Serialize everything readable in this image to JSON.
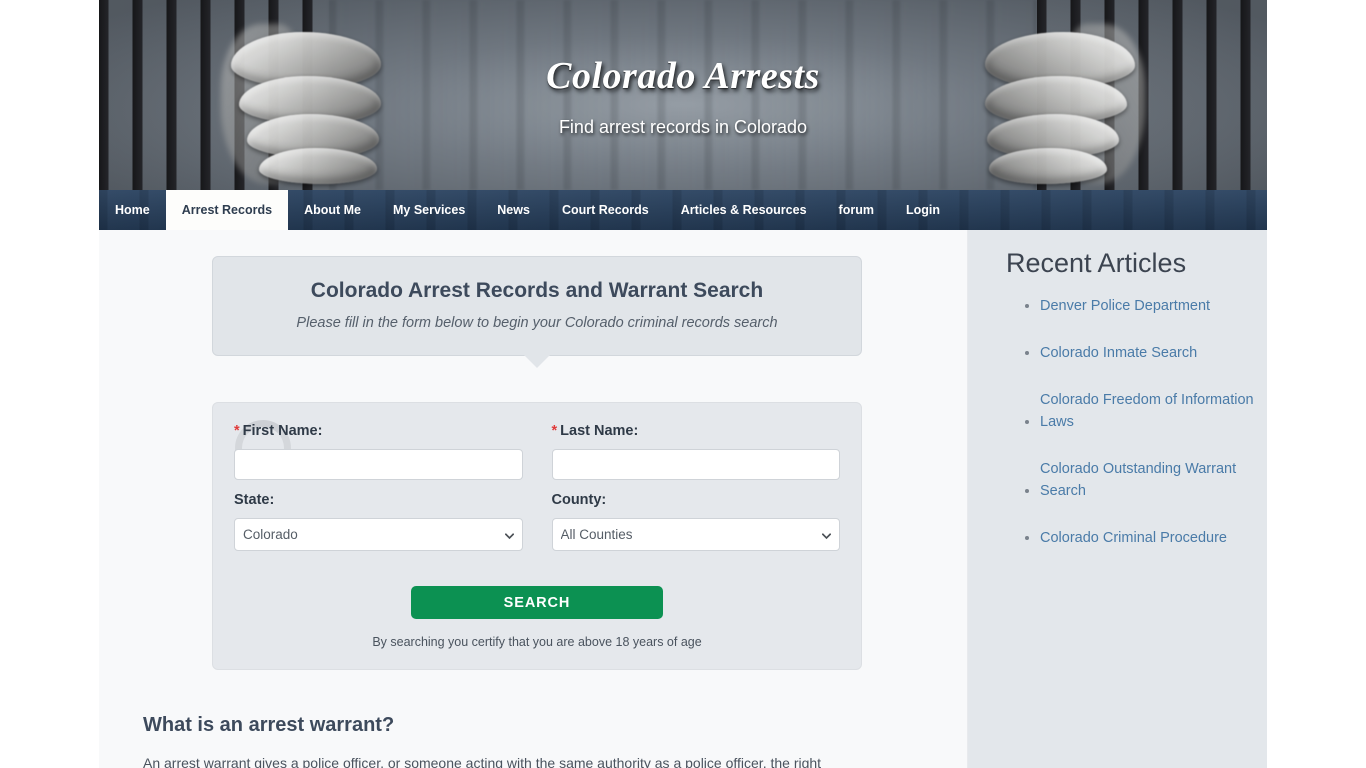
{
  "banner": {
    "title": "Colorado Arrests",
    "tagline": "Find arrest records in Colorado"
  },
  "nav": {
    "items": [
      {
        "label": "Home",
        "active": false
      },
      {
        "label": "Arrest Records",
        "active": true
      },
      {
        "label": "About Me",
        "active": false
      },
      {
        "label": "My Services",
        "active": false
      },
      {
        "label": "News",
        "active": false
      },
      {
        "label": "Court Records",
        "active": false
      },
      {
        "label": "Articles & Resources",
        "active": false
      },
      {
        "label": "forum",
        "active": false
      },
      {
        "label": "Login",
        "active": false
      }
    ]
  },
  "callout": {
    "title": "Colorado Arrest Records and Warrant Search",
    "subtitle": "Please fill in the form below to begin your Colorado criminal records search"
  },
  "form": {
    "first_name": {
      "label": "First Name:",
      "required_mark": "*",
      "value": "",
      "placeholder": ""
    },
    "last_name": {
      "label": "Last Name:",
      "required_mark": "*",
      "value": "",
      "placeholder": ""
    },
    "state": {
      "label": "State:",
      "selected": "Colorado",
      "options": [
        "Colorado"
      ]
    },
    "county": {
      "label": "County:",
      "selected": "All Counties",
      "options": [
        "All Counties"
      ]
    },
    "search_button": "SEARCH",
    "disclaimer": "By searching you certify that you are above 18 years of age"
  },
  "article": {
    "heading": "What is an arrest warrant?",
    "paragraph": "An arrest warrant gives a police officer, or someone acting with the same authority as a police officer, the right"
  },
  "sidebar": {
    "title": "Recent Articles",
    "links": [
      "Denver Police Department",
      "Colorado Inmate Search",
      "Colorado Freedom of Information Laws",
      "Colorado Outstanding Warrant Search",
      "Colorado Criminal Procedure"
    ]
  },
  "colors": {
    "nav_bg": "#27405e",
    "accent_green": "#0c9152",
    "link_blue": "#4a7ba8",
    "heading_slate": "#3d4a5c",
    "required_red": "#e03a3a",
    "sidebar_bg": "#e3e7eb",
    "main_bg": "#f8f9fa"
  }
}
